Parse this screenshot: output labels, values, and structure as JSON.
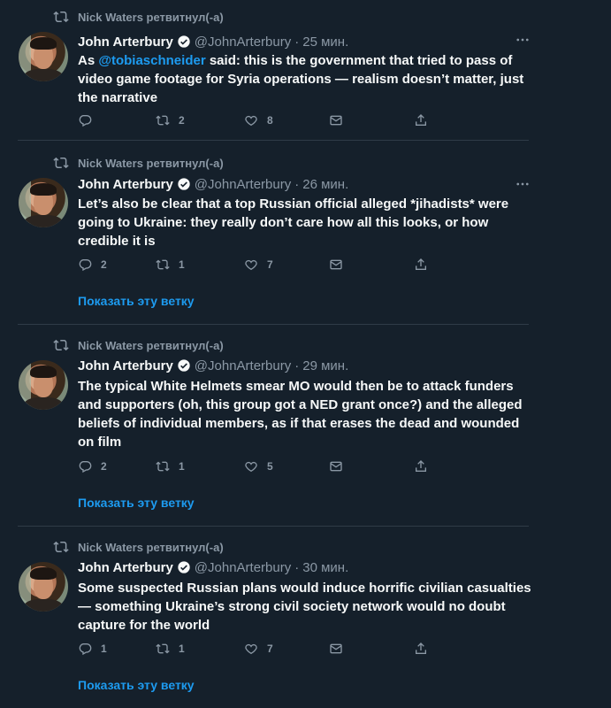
{
  "colors": {
    "background": "#15202b",
    "primary_text": "#f7f9f9",
    "secondary_text": "#8b98a5",
    "accent": "#1d9bf0",
    "separator": "#2f3b47"
  },
  "tweets": [
    {
      "retweet_label": "Nick Waters ретвитнул(-а)",
      "author_name": "John Arterbury",
      "author_handle": "@JohnArterbury",
      "separator_dot": "·",
      "time": "25 мин.",
      "text_prefix": "As ",
      "text_mention": "@tobiaschneider",
      "text_body": " said: this is the government that tried to pass of video game footage for Syria operations — realism doesn’t matter, just the narrative",
      "replies": "",
      "retweets": "2",
      "likes": "8",
      "show_thread": ""
    },
    {
      "retweet_label": "Nick Waters ретвитнул(-а)",
      "author_name": "John Arterbury",
      "author_handle": "@JohnArterbury",
      "separator_dot": "·",
      "time": "26 мин.",
      "text_prefix": "",
      "text_mention": "",
      "text_body": "Let’s also be clear that a top Russian official alleged *jihadists* were going to Ukraine: they really don’t care how all this looks, or how credible it is",
      "replies": "2",
      "retweets": "1",
      "likes": "7",
      "show_thread": "Показать эту ветку"
    },
    {
      "retweet_label": "Nick Waters ретвитнул(-а)",
      "author_name": "John Arterbury",
      "author_handle": "@JohnArterbury",
      "separator_dot": "·",
      "time": "29 мин.",
      "text_prefix": "",
      "text_mention": "",
      "text_body": "The typical White Helmets smear MO would then be to attack funders and supporters (oh, this group got a NED grant once?) and the alleged beliefs of individual members, as if that erases the dead and wounded on film",
      "replies": "2",
      "retweets": "1",
      "likes": "5",
      "show_thread": "Показать эту ветку"
    },
    {
      "retweet_label": "Nick Waters ретвитнул(-а)",
      "author_name": "John Arterbury",
      "author_handle": "@JohnArterbury",
      "separator_dot": "·",
      "time": "30 мин.",
      "text_prefix": "",
      "text_mention": "",
      "text_body": "Some suspected Russian plans would induce horrific civilian casualties — something Ukraine’s strong civil society network would no doubt capture for the world",
      "replies": "1",
      "retweets": "1",
      "likes": "7",
      "show_thread": "Показать эту ветку"
    }
  ],
  "icons": {
    "retweet": "retweet-icon",
    "reply": "reply-icon",
    "like": "heart-icon",
    "message": "envelope-icon",
    "share": "share-icon",
    "more": "more-icon",
    "verified": "verified-badge-icon"
  }
}
